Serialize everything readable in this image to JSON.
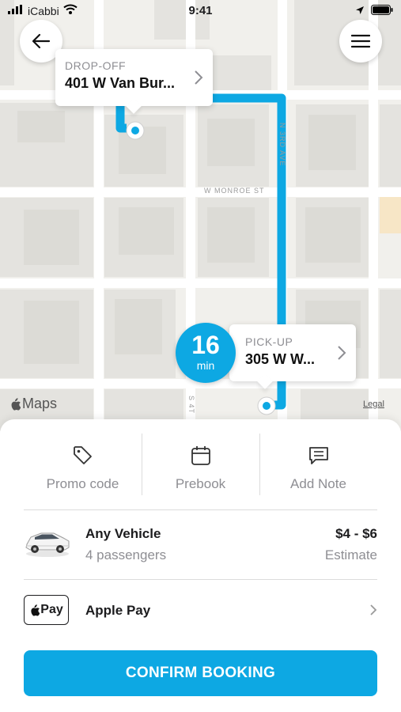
{
  "status_bar": {
    "carrier": "iCabbi",
    "time": "9:41"
  },
  "map": {
    "streets": {
      "monroe": "W MONROE ST",
      "third_ave": "N 3RD AVE",
      "fourth": "S 4T"
    },
    "attribution": "Maps",
    "legal": "Legal",
    "route_color": "#0da8e3"
  },
  "dropoff": {
    "label": "DROP-OFF",
    "address": "401 W Van Bur..."
  },
  "pickup": {
    "label": "PICK-UP",
    "address": "305 W W..."
  },
  "eta": {
    "value": "16",
    "unit": "min"
  },
  "actions": [
    {
      "label": "Promo code",
      "icon": "tag-icon"
    },
    {
      "label": "Prebook",
      "icon": "calendar-icon"
    },
    {
      "label": "Add Note",
      "icon": "note-icon"
    }
  ],
  "vehicle": {
    "name": "Any Vehicle",
    "passengers": "4 passengers",
    "price": "$4 - $6",
    "price_note": "Estimate"
  },
  "payment": {
    "badge": "Pay",
    "label": "Apple Pay"
  },
  "confirm": {
    "label": "CONFIRM BOOKING"
  },
  "colors": {
    "accent": "#0da8e3"
  }
}
